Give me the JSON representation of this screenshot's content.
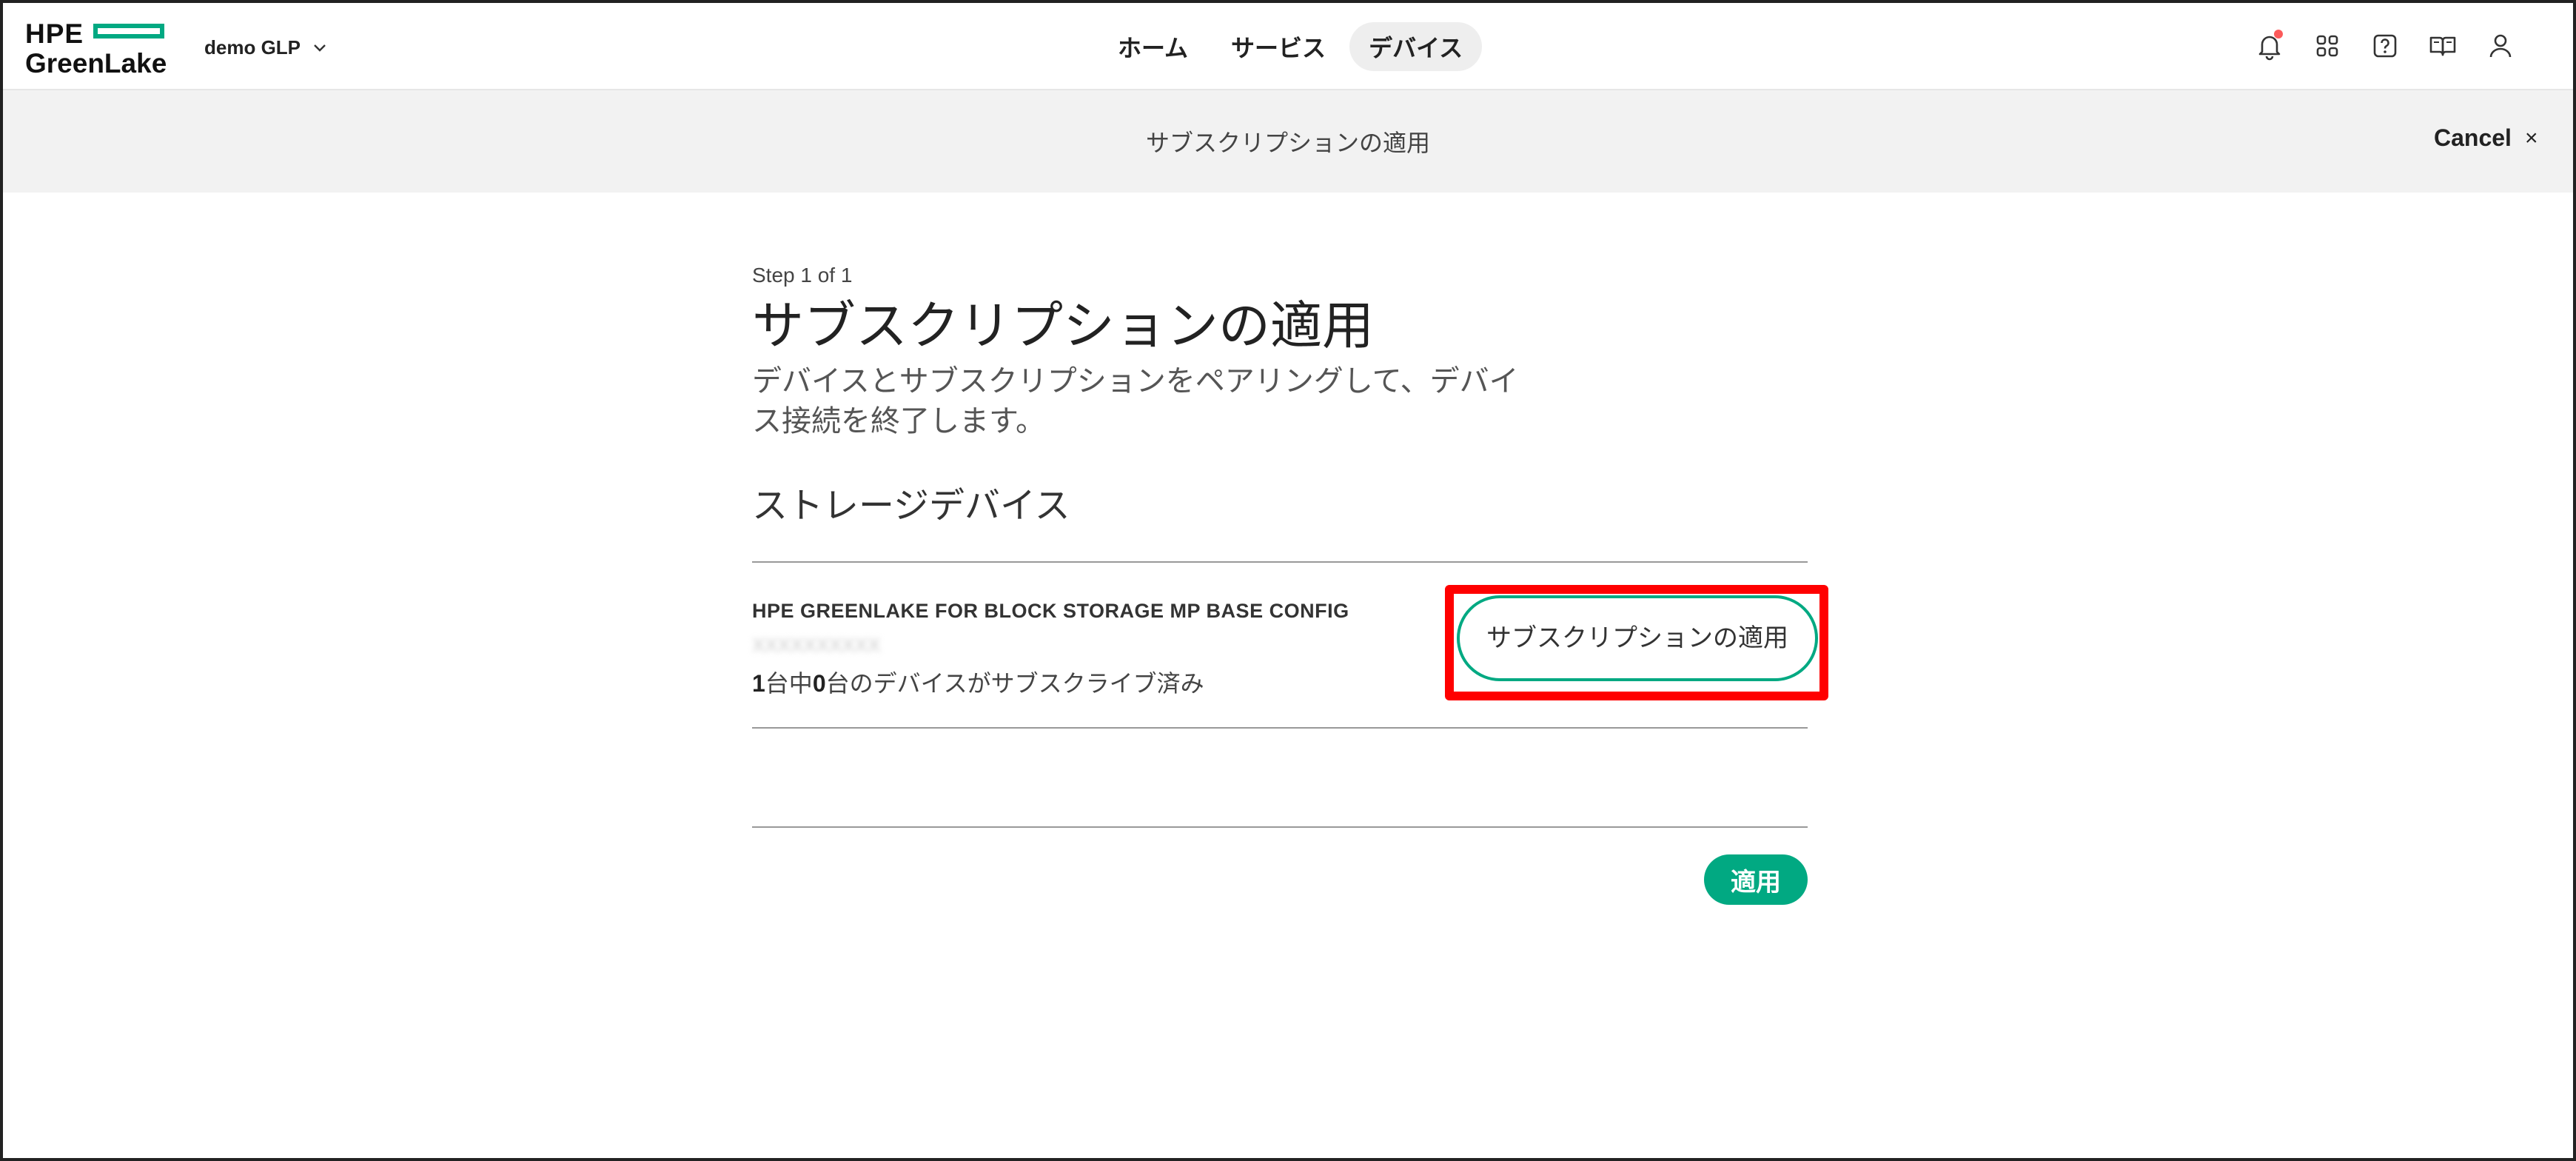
{
  "header": {
    "logo": {
      "line1": "HPE",
      "line2": "GreenLake"
    },
    "workspace": "demo GLP",
    "nav": [
      {
        "label": "ホーム",
        "active": false
      },
      {
        "label": "サービス",
        "active": false
      },
      {
        "label": "デバイス",
        "active": true
      }
    ],
    "icons": [
      "bell-icon",
      "apps-grid-icon",
      "help-icon",
      "book-icon",
      "user-icon"
    ],
    "notification_dot_color": "#fc5a5a"
  },
  "subheader": {
    "title": "サブスクリプションの適用",
    "cancel_label": "Cancel",
    "cancel_icon": "×"
  },
  "content": {
    "step": "Step 1 of 1",
    "title": "サブスクリプションの適用",
    "subtitle": "デバイスとサブスクリプションをペアリングして、デバイス接続を終了します。",
    "section_title": "ストレージデバイス",
    "device": {
      "product_name": "HPE GREENLAKE FOR BLOCK STORAGE MP BASE CONFIG",
      "serial_masked": "XXXXXXXXXX",
      "subscribed_total": "1",
      "subscribed_text_1": "台中",
      "subscribed_count": "0",
      "subscribed_text_2": "台のデバイスがサブスクライブ済み",
      "apply_subscription_label": "サブスクリプションの適用"
    },
    "apply_label": "適用"
  },
  "colors": {
    "brand_green": "#01a982",
    "highlight_red": "#ff0000"
  }
}
